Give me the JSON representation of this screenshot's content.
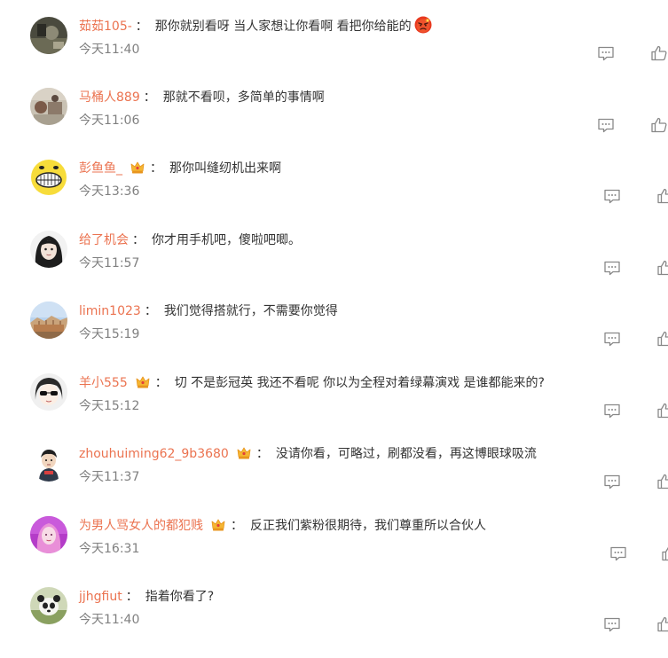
{
  "comments": [
    {
      "username": "茹茹105-",
      "vip": false,
      "content": "那你就别看呀 当人家想让你看啊 看把你给能的",
      "emoji": "angry-face-emoji",
      "time": "今天11:40"
    },
    {
      "username": "马桶人889",
      "vip": false,
      "content": "那就不看呗，多简单的事情啊",
      "emoji": null,
      "time": "今天11:06"
    },
    {
      "username": "彭鱼鱼_",
      "vip": true,
      "content": "那你叫缝纫机出来啊",
      "emoji": null,
      "time": "今天13:36"
    },
    {
      "username": "给了机会",
      "vip": false,
      "content": "你才用手机吧，傻啦吧唧。",
      "emoji": null,
      "time": "今天11:57"
    },
    {
      "username": "limin1023",
      "vip": false,
      "content": "我们觉得搭就行，不需要你觉得",
      "emoji": null,
      "time": "今天15:19"
    },
    {
      "username": "羊小555",
      "vip": true,
      "content": "切 不是彭冠英 我还不看呢 你以为全程对着绿幕演戏 是谁都能来的?",
      "emoji": null,
      "time": "今天15:12"
    },
    {
      "username": "zhouhuiming62_9b3680",
      "vip": true,
      "content": "没请你看，可略过，刷都没看，再这博眼球吸流",
      "emoji": null,
      "time": "今天11:37"
    },
    {
      "username": "为男人骂女人的都犯贱",
      "vip": true,
      "content": "反正我们紫粉很期待，我们尊重所以合伙人",
      "emoji": null,
      "time": "今天16:31"
    },
    {
      "username": "jjhgfiut",
      "vip": false,
      "content": "指着你看了?",
      "emoji": null,
      "time": "今天11:40"
    }
  ],
  "separator": "：",
  "icons": {
    "reply": "comment-icon",
    "like": "thumbs-up-icon",
    "vip": "crown-badge-icon"
  },
  "colors": {
    "username": "#eb7350",
    "text": "#333333",
    "time": "#808080",
    "icon": "#888888"
  }
}
